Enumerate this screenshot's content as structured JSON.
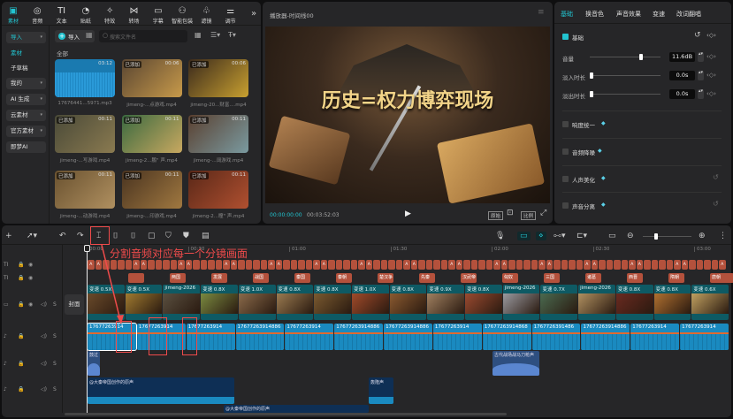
{
  "top_tabs": [
    {
      "label": "素材",
      "icon": "media-icon"
    },
    {
      "label": "音频",
      "icon": "audio-icon"
    },
    {
      "label": "文本",
      "icon": "text-icon"
    },
    {
      "label": "贴纸",
      "icon": "sticker-icon"
    },
    {
      "label": "特效",
      "icon": "effects-icon"
    },
    {
      "label": "转场",
      "icon": "transition-icon"
    },
    {
      "label": "字幕",
      "icon": "caption-icon"
    },
    {
      "label": "智能包装",
      "icon": "smart-pack-icon"
    },
    {
      "label": "滤镜",
      "icon": "filter-icon"
    },
    {
      "label": "调节",
      "icon": "adjust-icon"
    }
  ],
  "more": "»",
  "sidebar": [
    "导入",
    "素材",
    "子草稿",
    "我的",
    "AI 生成",
    "云素材",
    "官方素材",
    "即梦AI"
  ],
  "media": {
    "import_label": "导入",
    "search_placeholder": "搜索文件名",
    "section": "全部",
    "items": [
      {
        "name": "17676441...5971.mp3",
        "duration": "03:12",
        "badge": "",
        "type": "audio"
      },
      {
        "name": "jimeng-...点游戏.mp4",
        "duration": "00:06",
        "badge": "已添加",
        "colors": [
          "#5a4632",
          "#c89a4a"
        ]
      },
      {
        "name": "jimeng-20...财富....mp4",
        "duration": "00:06",
        "badge": "已添加",
        "colors": [
          "#3b2a1c",
          "#c8a030"
        ]
      },
      {
        "name": "jimeng-...写游戏.mp4",
        "duration": "00:11",
        "badge": "已添加",
        "colors": [
          "#4a4a38",
          "#8a7a50"
        ]
      },
      {
        "name": "jimeng-2...鹏\" 声.mp4",
        "duration": "00:11",
        "badge": "已添加",
        "colors": [
          "#3b6a40",
          "#c8a860"
        ]
      },
      {
        "name": "jimeng-...阔游戏.mp4",
        "duration": "00:11",
        "badge": "已添加",
        "colors": [
          "#5a4030",
          "#7a9aa0"
        ]
      },
      {
        "name": "jimeng-...动游戏.mp4",
        "duration": "00:11",
        "badge": "已添加",
        "colors": [
          "#6a5230",
          "#b09060"
        ]
      },
      {
        "name": "jimeng-...印游戏.mp4",
        "duration": "00:11",
        "badge": "已添加",
        "colors": [
          "#4a3420",
          "#a07840"
        ]
      },
      {
        "name": "jimeng-2...瞳\" 声.mp4",
        "duration": "00:11",
        "badge": "已添加",
        "colors": [
          "#5a2818",
          "#b05030"
        ]
      }
    ]
  },
  "player": {
    "title": "播放器-时间线00",
    "video_title": "历史=权力博弈现场",
    "current_time": "00:00:00:00",
    "total_time": "00:03:52:03",
    "ratio_label": "比例",
    "quality_label": "原始"
  },
  "right": {
    "tabs": [
      "基础",
      "换音色",
      "声音效果",
      "变速",
      "改词翻唱"
    ],
    "section": "基础",
    "volume": {
      "label": "音量",
      "value": "11.6dB",
      "level": 0.82
    },
    "fade_in": {
      "label": "淡入时长",
      "value": "0.0s"
    },
    "fade_out": {
      "label": "淡出时长",
      "value": "0.0s"
    },
    "options": [
      "响度统一",
      "音频降噪",
      "人声美化",
      "声音分离"
    ]
  },
  "timeline": {
    "ruler": [
      "00:00",
      "00:30",
      "01:00",
      "01:30",
      "02:00",
      "02:30",
      "03:00"
    ],
    "annotation": "分割音频对应每一个分镜画面",
    "cover_label": "封面",
    "subtitles": [
      "",
      "两国",
      "发展",
      "战国",
      "秦国",
      "秦朝",
      "楚汉争",
      "先秦",
      "汉武帝",
      "匈奴",
      "三国",
      "诸葛",
      "西晋",
      "隋朝",
      "唐朝"
    ],
    "video_clips": [
      "变速 0.5X",
      "变速 0.5X",
      "jimeng-2026",
      "变速 0.8X",
      "变速 1.0X",
      "变速 0.8X",
      "变速 0.8X",
      "变速 1.0X",
      "变速 0.8X",
      "变速 0.9X",
      "变速 0.8X",
      "jimeng-2026",
      "变速 0.7X",
      "jimeng-2026",
      "变速 0.8X",
      "变速 0.8X",
      "变速 0.6X"
    ],
    "audio_clips": [
      "17677263914",
      "17677263914",
      "17677263914",
      "17677263914886",
      "17677263914",
      "17677263914886",
      "17677263914886",
      "17677263914",
      "17677263914868",
      "1767726391486",
      "17677263914886",
      "17677263914",
      "17677263914"
    ],
    "sfx": [
      {
        "label": "鼓过"
      },
      {
        "label": "古代战场战马刀枪声"
      }
    ],
    "music": [
      {
        "label": "@大秦帝国创作的原声"
      },
      {
        "label": "轰隆声"
      }
    ],
    "music2": {
      "label": "@大秦帝国创作的原声"
    }
  },
  "colors": {
    "accent": "#22c4d0",
    "annotation": "#f04b4b",
    "text_clip": "#b4513c",
    "audio_clip": "#1a8ac0",
    "video_clip": "#0e5a64"
  }
}
